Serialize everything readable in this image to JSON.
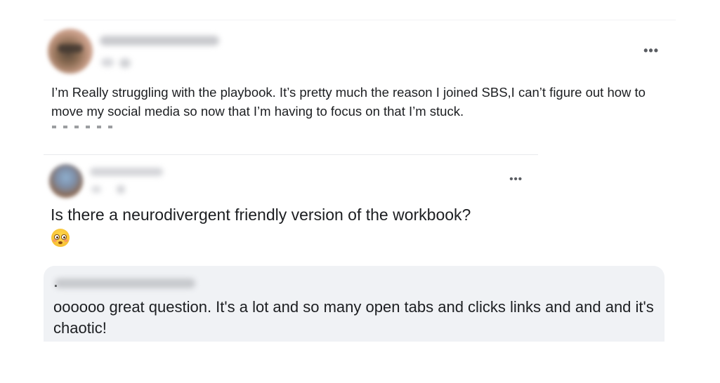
{
  "posts": [
    {
      "menu_icon": "more-horizontal-icon",
      "menu_label": "•••",
      "text": "I’m Really struggling with the playbook. It’s pretty much the reason I joined SBS,I can’t figure out how to move my social media so now that I’m having to focus on that I’m stuck."
    },
    {
      "menu_icon": "more-horizontal-icon",
      "menu_label": "•••",
      "text": "Is there a neurodivergent friendly version of the workbook?",
      "emoji": "flushed-face"
    }
  ],
  "comment": {
    "text": "oooooo great question. It's a lot and so many open tabs and clicks links and and and it's chaotic!"
  }
}
